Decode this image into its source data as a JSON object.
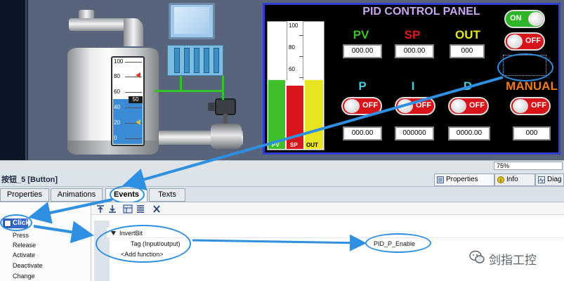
{
  "hmi": {
    "zoom": "75%",
    "gauge": {
      "ticks": [
        "100",
        "80",
        "60",
        "40",
        "20",
        "0"
      ],
      "value": "50"
    },
    "bar_scale": [
      "100",
      "80",
      "60"
    ],
    "bar_labels": [
      "PV",
      "SP",
      "OUT"
    ],
    "pid_panel": {
      "title": "PID CONTROL PANEL",
      "labels": {
        "pv": "PV",
        "sp": "SP",
        "out": "OUT",
        "p": "P",
        "i": "I",
        "d": "D",
        "manual": "MANUAL"
      },
      "values": {
        "pv": "000.00",
        "sp": "000.00",
        "out": "000",
        "p": "000.00",
        "i": "000000",
        "d": "0000.00",
        "manual": "000"
      },
      "toggles": {
        "on_label": "ON",
        "off_label": "OFF"
      },
      "colors": {
        "pv": "#3fbf28",
        "sp": "#d8161b",
        "out": "#e8e421",
        "manual": "#f07a1c",
        "title": "#c9a6f0"
      }
    }
  },
  "inspector": {
    "title": "按钮_5 [Button]",
    "right_tabs": {
      "properties": "Properties",
      "info": "Info",
      "diag": "Diag"
    },
    "tabs": [
      "Properties",
      "Animations",
      "Events",
      "Texts"
    ],
    "active_tab": "Events",
    "events": [
      "Click",
      "Press",
      "Release",
      "Activate",
      "Deactivate",
      "Change"
    ],
    "selected_event": "Click",
    "functions": {
      "function_name": "InvertBit",
      "param_label": "Tag (Input/output)",
      "param_value": "PID_P_Enable",
      "add_function": "<Add function>"
    }
  },
  "watermark": "剑指工控"
}
